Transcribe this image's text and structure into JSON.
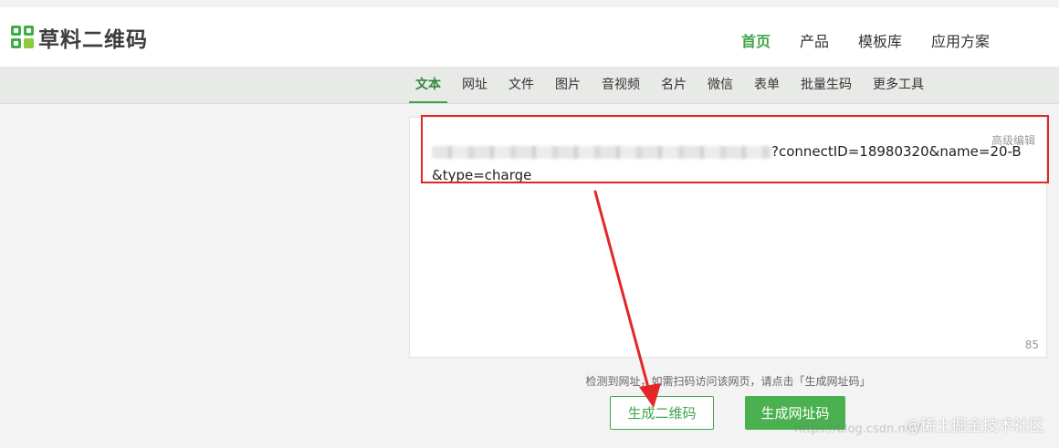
{
  "header": {
    "logo_text": "草料二维码",
    "nav": [
      {
        "label": "首页",
        "active": true
      },
      {
        "label": "产品",
        "active": false
      },
      {
        "label": "模板库",
        "active": false
      },
      {
        "label": "应用方案",
        "active": false
      }
    ]
  },
  "subnav": {
    "tabs": [
      {
        "label": "文本",
        "active": true
      },
      {
        "label": "网址",
        "active": false
      },
      {
        "label": "文件",
        "active": false
      },
      {
        "label": "图片",
        "active": false
      },
      {
        "label": "音视频",
        "active": false
      },
      {
        "label": "名片",
        "active": false
      },
      {
        "label": "微信",
        "active": false
      },
      {
        "label": "表单",
        "active": false
      },
      {
        "label": "批量生码",
        "active": false
      },
      {
        "label": "更多工具",
        "active": false
      }
    ]
  },
  "editor": {
    "advanced_label": "高级编辑",
    "content_visible": "?connectID=18980320&name=20-B&type=charge",
    "char_count": "85"
  },
  "hint": "检测到网址，如需扫码访问该网页，请点击「生成网址码」",
  "buttons": {
    "qrcode": "生成二维码",
    "urlcode": "生成网址码"
  },
  "watermark": {
    "main": "@稀土掘金技术社区",
    "faint": "https://blog.csdn.net/..."
  },
  "colors": {
    "brand_green": "#3fa54a",
    "annotation_red": "#e42626"
  }
}
